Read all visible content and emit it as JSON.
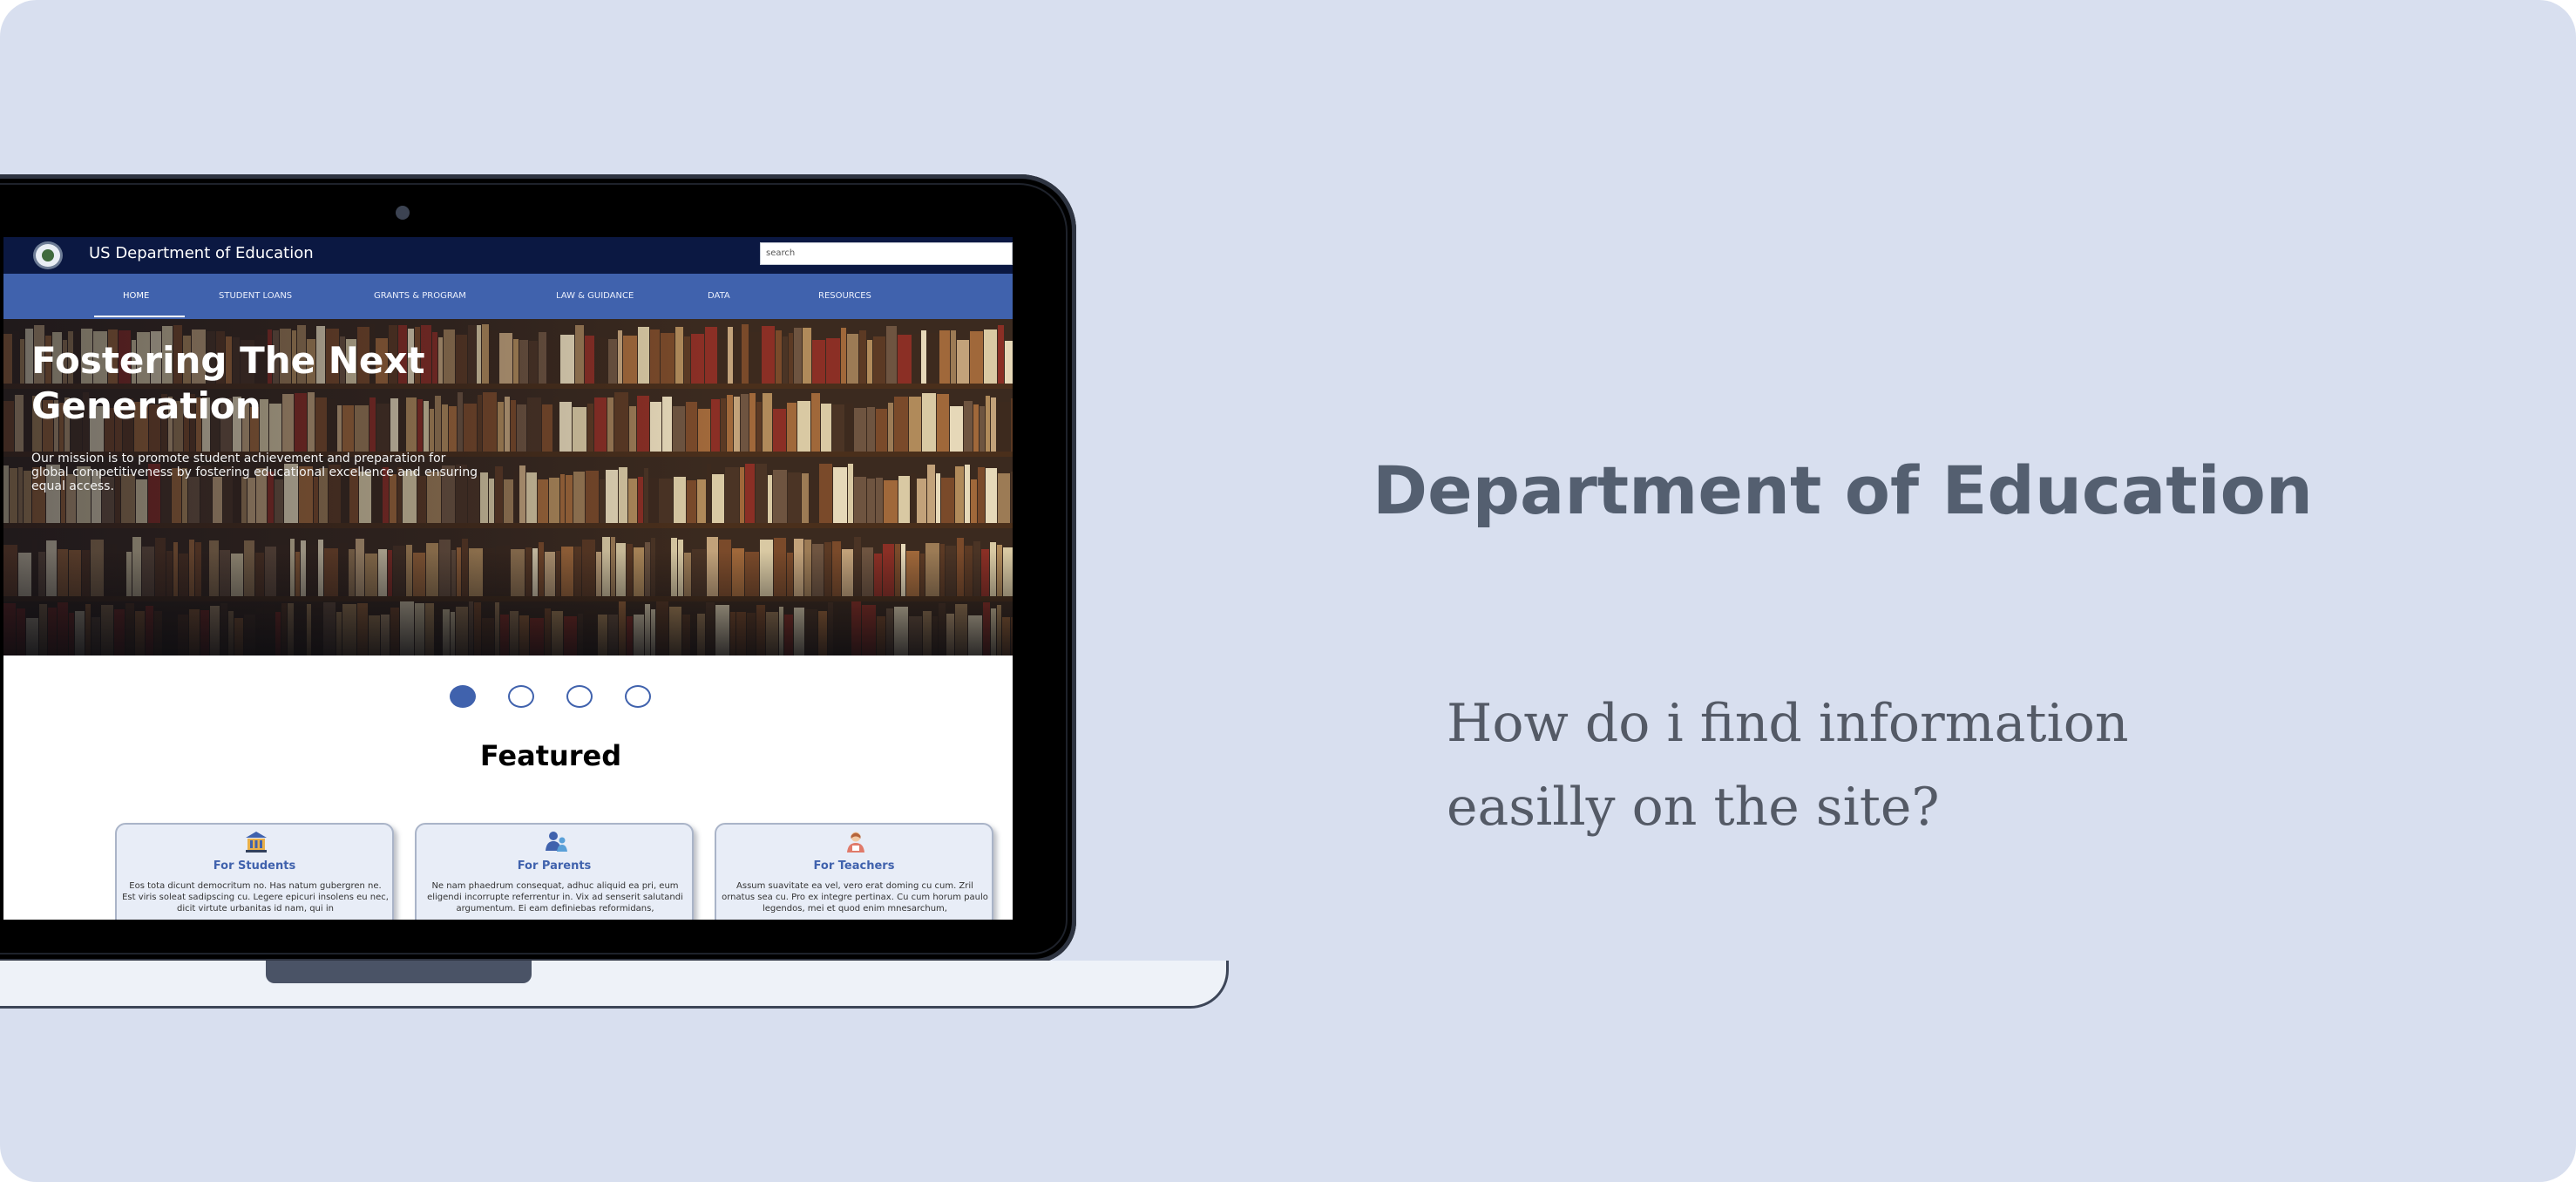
{
  "site": {
    "title": "US Department of Education",
    "search_placeholder": "search",
    "nav": [
      "HOME",
      "STUDENT LOANS",
      "GRANTS & PROGRAM",
      "LAW & GUIDANCE",
      "DATA",
      "RESOURCES"
    ],
    "active_nav": "HOME",
    "hero": {
      "title": "Fostering The Next Generation",
      "subtitle": "Our mission is to promote student achievement and preparation for global competitiveness by fostering educational excellence and ensuring equal access."
    },
    "carousel": {
      "slides": 4,
      "active_slide": 1
    },
    "featured_heading": "Featured",
    "cards": [
      {
        "title": "For Students",
        "icon": "school-building-icon",
        "text": "Eos tota dicunt democritum no. Has natum gubergren ne. Est viris soleat sadipscing cu. Legere epicuri insolens eu nec, dicit virtute urbanitas id nam, qui in"
      },
      {
        "title": "For Parents",
        "icon": "parent-child-icon",
        "text": "Ne nam phaedrum consequat, adhuc aliquid ea pri, eum eligendi incorrupte referrentur in. Vix ad senserit salutandi argumentum. Ei eam definiebas reformidans,"
      },
      {
        "title": "For Teachers",
        "icon": "teacher-icon",
        "text": "Assum suavitate ea vel, vero erat doming cu cum. Zril ornatus sea cu. Pro ex integre pertinax. Cu cum horum paulo legendos, mei et quod enim mnesarchum,"
      }
    ]
  },
  "slide": {
    "heading": "Department of Education",
    "question_line1": "How do i find information",
    "question_line2": "easilly on the site?"
  },
  "colors": {
    "background": "#d8dfef",
    "topbar": "#0b1842",
    "navbar": "#4062ad",
    "accent": "#4062ad",
    "heading_text": "#545f70"
  }
}
